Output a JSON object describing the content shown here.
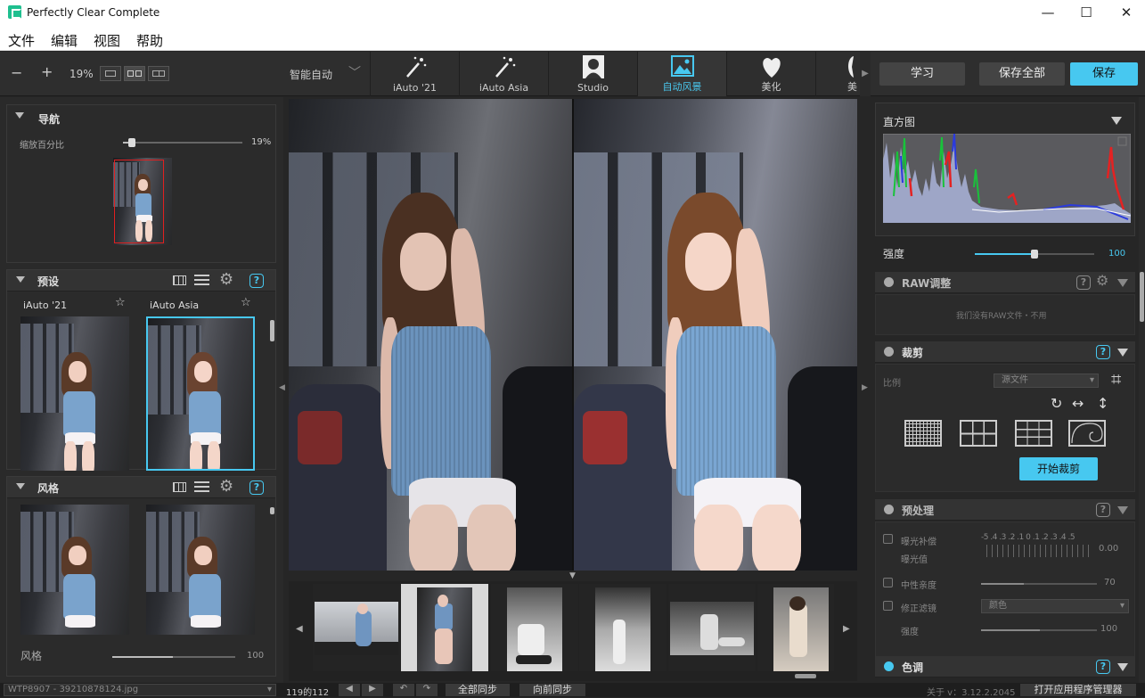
{
  "app": {
    "title": "Perfectly Clear Complete"
  },
  "menu": [
    "文件",
    "编辑",
    "视图",
    "帮助"
  ],
  "toolbar": {
    "zoom": "19%",
    "smart_auto": "智能自动",
    "presets": [
      {
        "label": "iAuto '21",
        "icon": "magic-wand-icon"
      },
      {
        "label": "iAuto Asia",
        "icon": "magic-wand-icon"
      },
      {
        "label": "Studio",
        "icon": "portrait-icon"
      },
      {
        "label": "自动风景",
        "icon": "landscape-icon",
        "active": true
      },
      {
        "label": "美化",
        "icon": "heart-icon"
      },
      {
        "label": "美",
        "icon": "face-icon"
      }
    ],
    "learn": "学习",
    "save_all": "保存全部",
    "save": "保存"
  },
  "nav": {
    "title": "导航",
    "zoom_label": "缩放百分比",
    "zoom_value": "19%",
    "zoom_level": 0.19
  },
  "presets_panel": {
    "title": "预设",
    "items": [
      {
        "name": "iAuto '21"
      },
      {
        "name": "iAuto Asia",
        "selected": true
      }
    ]
  },
  "styles_panel": {
    "title": "风格",
    "footer_label": "风格",
    "footer_value": "100"
  },
  "right": {
    "histogram_title": "直方图",
    "strength_label": "强度",
    "strength_value": "100",
    "raw": {
      "title": "RAW调整",
      "msg": "我们没有RAW文件・不用"
    },
    "crop": {
      "title": "裁剪",
      "ratio_label": "比例",
      "ratio_value": "源文件",
      "start": "开始裁剪"
    },
    "pre": {
      "title": "预处理",
      "exposure_label": "曝光补偿",
      "exposure_sub": "曝光值",
      "exposure_scale": "-5 .4 .3 .2 .1 0 .1 .2 .3 .4 .5",
      "exposure_value": "0.00",
      "neutral_label": "中性亲度",
      "neutral_value": "70",
      "filter_label": "修正滤镜",
      "filter_value": "颜色",
      "intensity_label": "强度",
      "intensity_value": "100"
    },
    "tone": {
      "title": "色调"
    }
  },
  "status": {
    "file": "WTP8907 - 39210878124.jpg",
    "count": "119的112",
    "sync_all": "全部同步",
    "sync_prev": "向前同步",
    "version": "关于 v：3.12.2.2045",
    "open_manager": "打开应用程序管理器"
  },
  "colors": {
    "accent": "#47c8f0",
    "bg": "#262626",
    "panel": "#2b2b2b"
  }
}
